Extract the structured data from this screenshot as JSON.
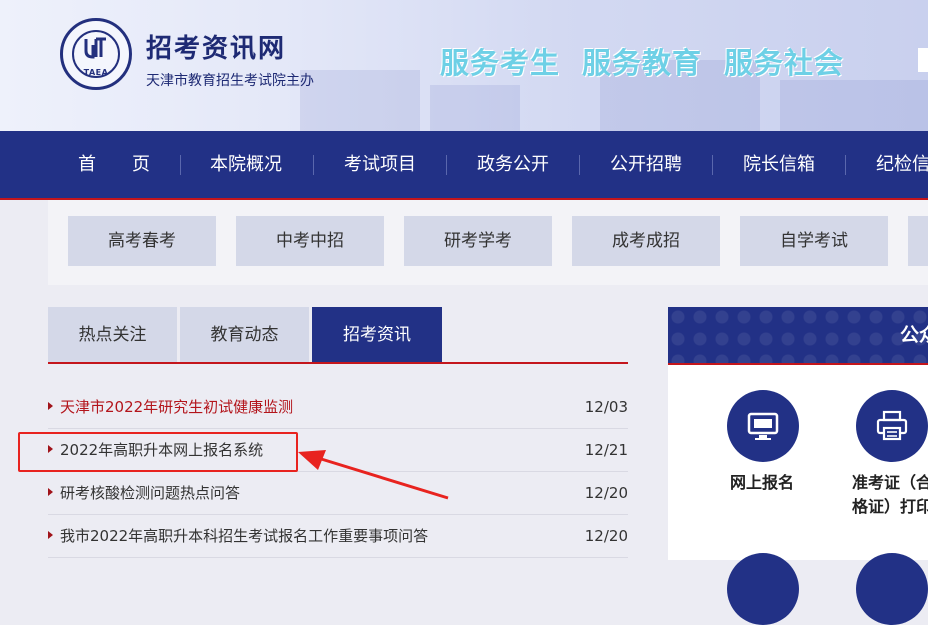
{
  "header": {
    "logo_abbr": "TAEA",
    "site_title": "招考资讯网",
    "site_subtitle": "天津市教育招生考试院主办",
    "slogans": [
      "服务考生",
      "服务教育",
      "服务社会"
    ]
  },
  "nav": {
    "items": [
      "首　　页",
      "本院概况",
      "考试项目",
      "政务公开",
      "公开招聘",
      "院长信箱",
      "纪检信"
    ]
  },
  "subnav": {
    "items": [
      "高考春考",
      "中考中招",
      "研考学考",
      "成考成招",
      "自学考试"
    ]
  },
  "tabs": {
    "items": [
      "热点关注",
      "教育动态",
      "招考资讯"
    ],
    "active_index": 2
  },
  "news": [
    {
      "title": "天津市2022年研究生初试健康监测",
      "date": "12/03",
      "hot": true
    },
    {
      "title": "2022年高职升本网上报名系统",
      "date": "12/21",
      "hot": false
    },
    {
      "title": "研考核酸检测问题热点问答",
      "date": "12/20",
      "hot": false
    },
    {
      "title": "我市2022年高职升本科招生考试报名工作重要事项问答",
      "date": "12/20",
      "hot": false
    }
  ],
  "panel": {
    "title": "公众",
    "services": [
      {
        "icon": "monitor-icon",
        "label": "网上报名"
      },
      {
        "icon": "printer-icon",
        "label_line1": "准考证（合",
        "label_line2": "格证）打印"
      }
    ]
  },
  "colors": {
    "nav_bg": "#223186",
    "accent_red": "#c4161c",
    "slogan": "#6ed0e6",
    "tab_inactive": "#d4d8e8"
  }
}
